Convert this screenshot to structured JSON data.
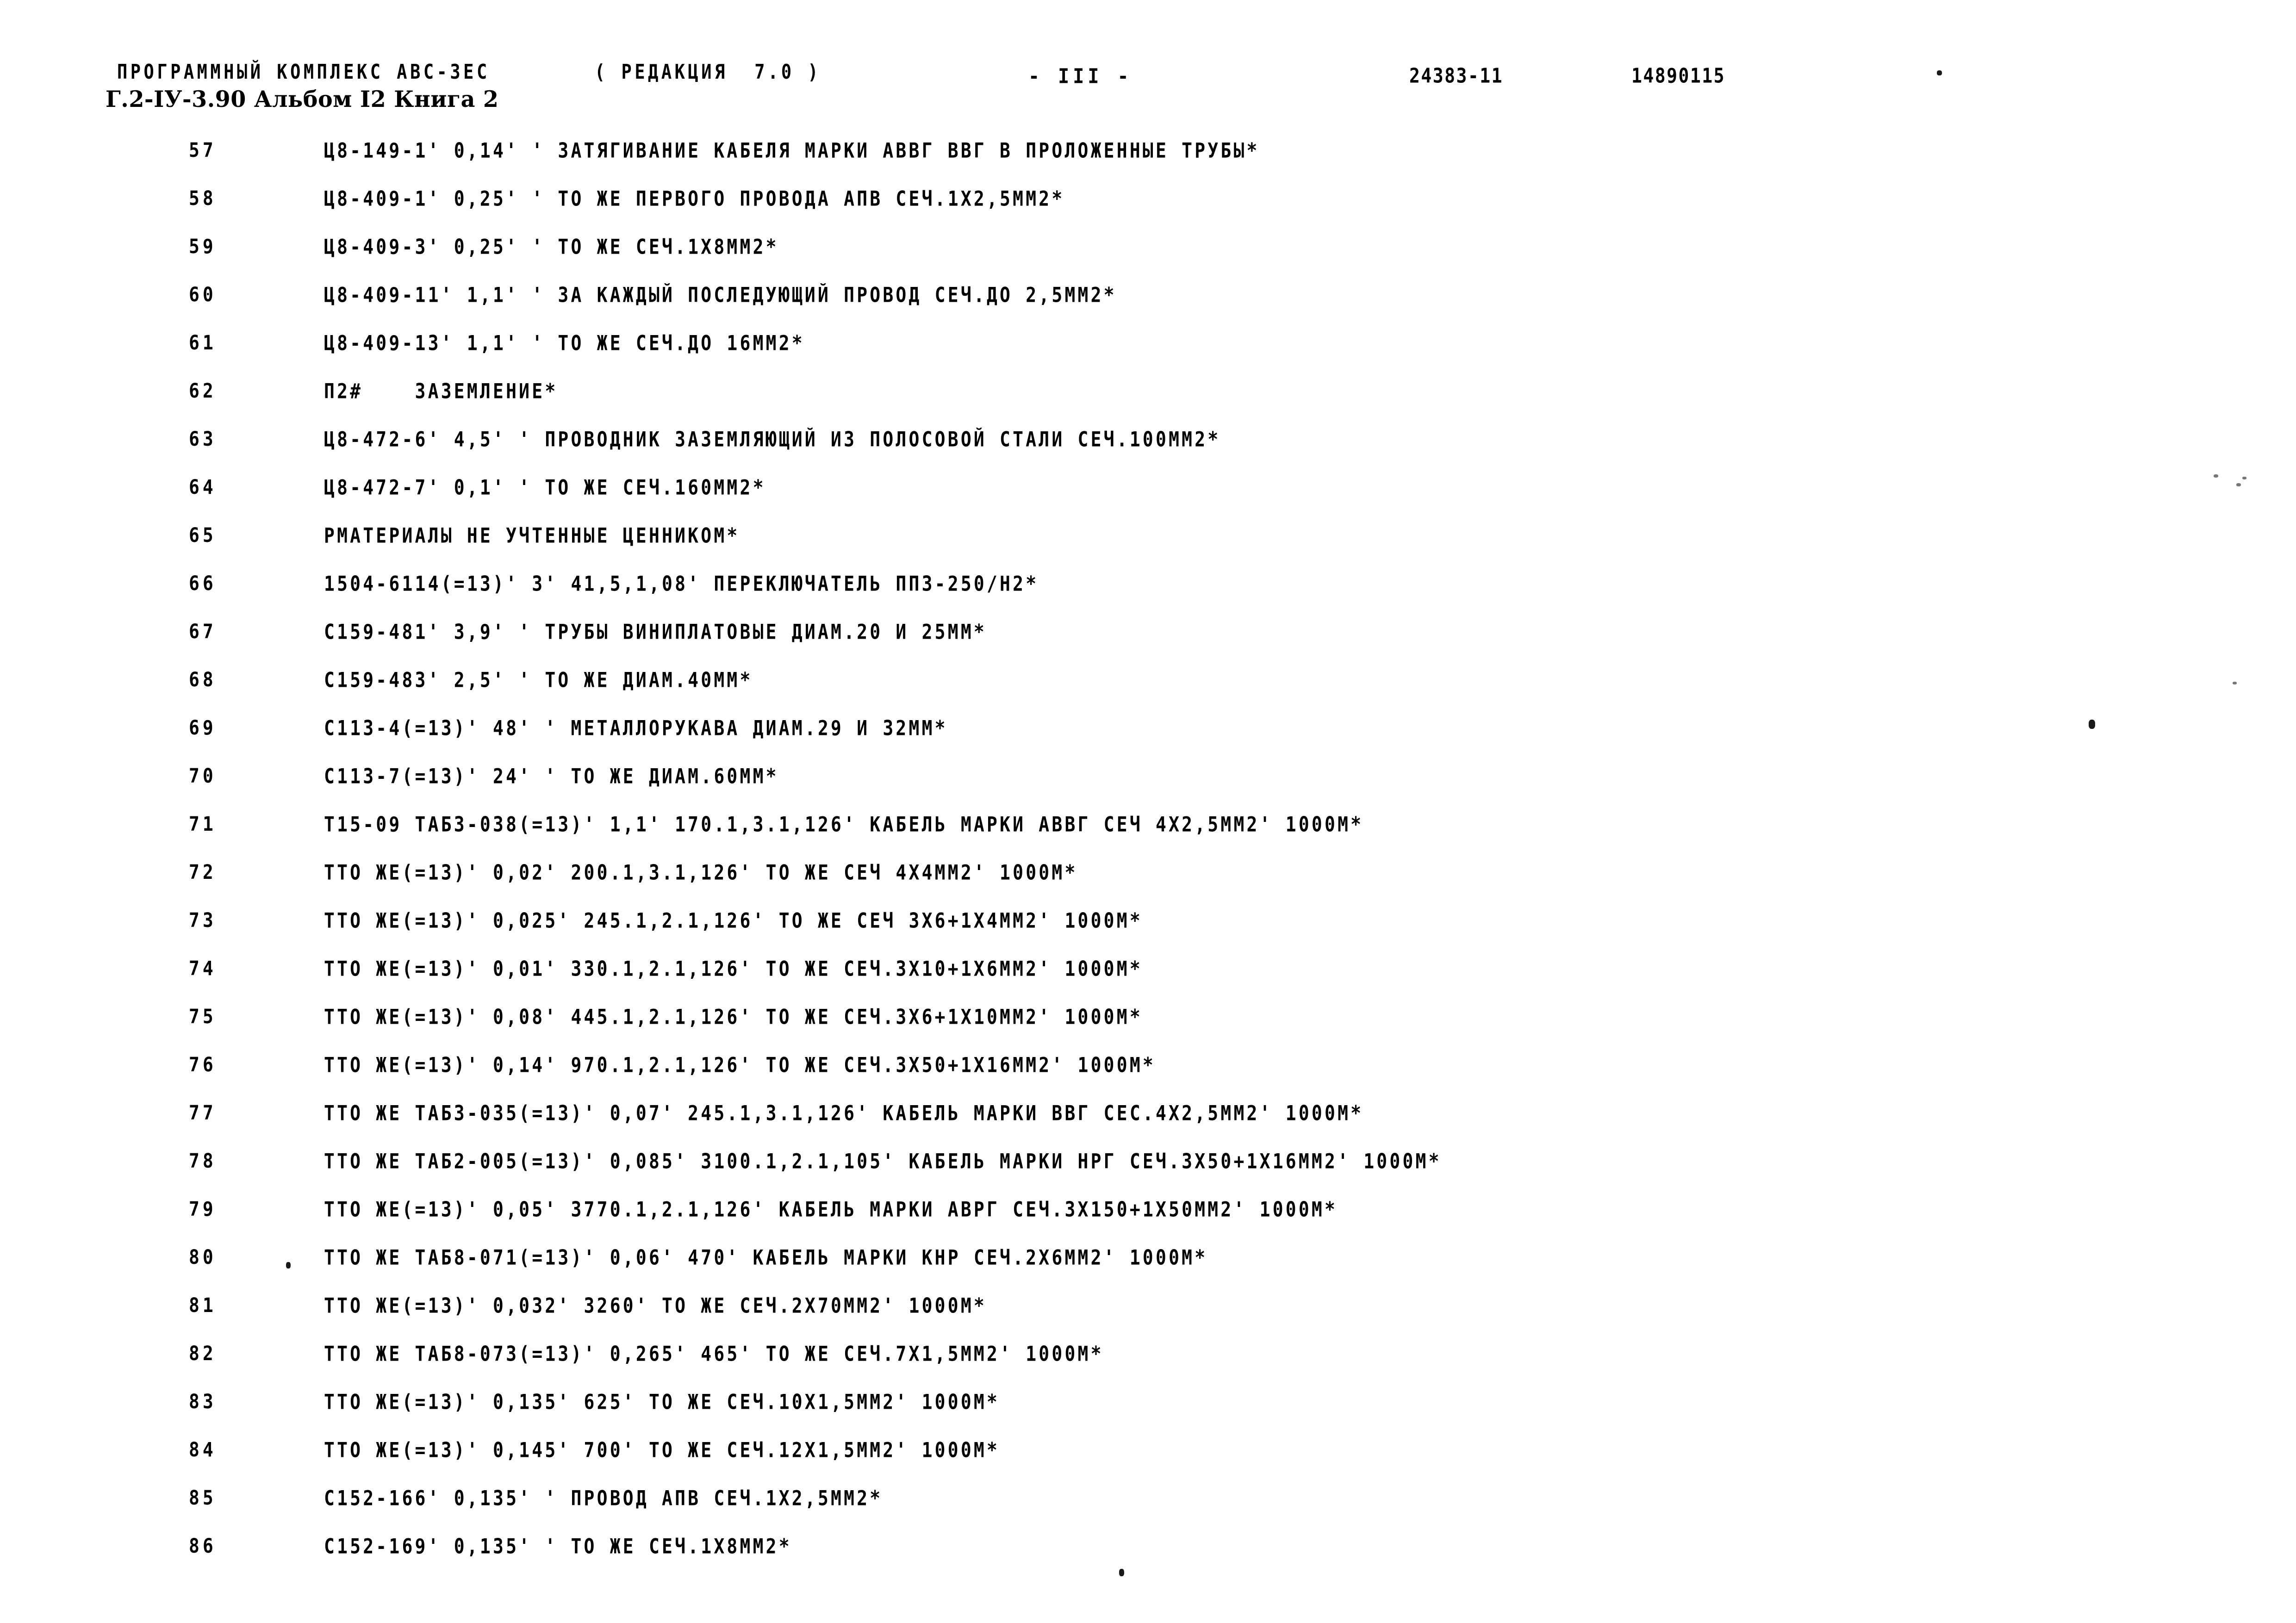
{
  "header": {
    "program_line": "ПРОГРАММНЫЙ КОМПЛЕКС АВС-3ЕС",
    "revision": "( РЕДАКЦИЯ  7.0 )",
    "album_line": "Г.2-IУ-3.90 Альбом I2 Книга 2",
    "page_number": "- III -",
    "code_left": "24383-11",
    "code_right": "14890115"
  },
  "rows": [
    {
      "num": "57",
      "text": "Ц8-149-1' 0,14' ' ЗАТЯГИВАНИЕ КАБЕЛЯ МАРКИ АВВГ ВВГ В ПРОЛОЖЕННЫЕ ТРУБЫ*"
    },
    {
      "num": "58",
      "text": "Ц8-409-1' 0,25' ' ТО ЖЕ ПЕРВОГО ПРОВОДА АПВ СЕЧ.1Х2,5ММ2*"
    },
    {
      "num": "59",
      "text": "Ц8-409-3' 0,25' ' ТО ЖЕ СЕЧ.1Х8ММ2*"
    },
    {
      "num": "60",
      "text": "Ц8-409-11' 1,1' ' ЗА КАЖДЫЙ ПОСЛЕДУЮЩИЙ ПРОВОД СЕЧ.ДО 2,5ММ2*"
    },
    {
      "num": "61",
      "text": "Ц8-409-13' 1,1' ' ТО ЖЕ СЕЧ.ДО 16ММ2*"
    },
    {
      "num": "62",
      "text": "П2#    ЗАЗЕМЛЕНИЕ*"
    },
    {
      "num": "63",
      "text": "Ц8-472-6' 4,5' ' ПРОВОДНИК ЗАЗЕМЛЯЮЩИЙ ИЗ ПОЛОСОВОЙ СТАЛИ СЕЧ.100ММ2*"
    },
    {
      "num": "64",
      "text": "Ц8-472-7' 0,1' ' ТО ЖЕ СЕЧ.160ММ2*"
    },
    {
      "num": "65",
      "text": "РМАТЕРИАЛЫ НЕ УЧТЕННЫЕ ЦЕННИКОМ*"
    },
    {
      "num": "66",
      "text": "1504-6114(=13)' 3' 41,5,1,08' ПЕРЕКЛЮЧАТЕЛЬ ПП3-250/Н2*"
    },
    {
      "num": "67",
      "text": "С159-481' 3,9' ' ТРУБЫ ВИНИПЛАТОВЫЕ ДИАМ.20 И 25ММ*"
    },
    {
      "num": "68",
      "text": "С159-483' 2,5' ' ТО ЖЕ ДИАМ.40ММ*"
    },
    {
      "num": "69",
      "text": "С113-4(=13)' 48' ' МЕТАЛЛОРУКАВА ДИАМ.29 И 32ММ*"
    },
    {
      "num": "70",
      "text": "С113-7(=13)' 24' ' ТО ЖЕ ДИАМ.60ММ*"
    },
    {
      "num": "71",
      "text": "Т15-09 ТАБ3-038(=13)' 1,1' 170.1,3.1,126' КАБЕЛЬ МАРКИ АВВГ СЕЧ 4Х2,5ММ2' 1000М*"
    },
    {
      "num": "72",
      "text": "ТТО ЖЕ(=13)' 0,02' 200.1,3.1,126' ТО ЖЕ СЕЧ 4Х4ММ2' 1000М*"
    },
    {
      "num": "73",
      "text": "ТТО ЖЕ(=13)' 0,025' 245.1,2.1,126' ТО ЖЕ СЕЧ 3Х6+1Х4ММ2' 1000М*"
    },
    {
      "num": "74",
      "text": "ТТО ЖЕ(=13)' 0,01' 330.1,2.1,126' ТО ЖЕ СЕЧ.3Х10+1Х6ММ2' 1000М*"
    },
    {
      "num": "75",
      "text": "ТТО ЖЕ(=13)' 0,08' 445.1,2.1,126' ТО ЖЕ СЕЧ.3Х6+1Х10ММ2' 1000М*"
    },
    {
      "num": "76",
      "text": "ТТО ЖЕ(=13)' 0,14' 970.1,2.1,126' ТО ЖЕ СЕЧ.3Х50+1Х16ММ2' 1000М*"
    },
    {
      "num": "77",
      "text": "ТТО ЖЕ ТАБ3-035(=13)' 0,07' 245.1,3.1,126' КАБЕЛЬ МАРКИ ВВГ СЕС.4Х2,5ММ2' 1000М*"
    },
    {
      "num": "78",
      "text": "ТТО ЖЕ ТАБ2-005(=13)' 0,085' 3100.1,2.1,105' КАБЕЛЬ МАРКИ НРГ СЕЧ.3Х50+1Х16ММ2' 1000М*"
    },
    {
      "num": "79",
      "text": "ТТО ЖЕ(=13)' 0,05' 3770.1,2.1,126' КАБЕЛЬ МАРКИ АВРГ СЕЧ.3Х150+1Х50ММ2' 1000М*"
    },
    {
      "num": "80",
      "text": "ТТО ЖЕ ТАБ8-071(=13)' 0,06' 470' КАБЕЛЬ МАРКИ КНР СЕЧ.2Х6ММ2' 1000М*"
    },
    {
      "num": "81",
      "text": "ТТО ЖЕ(=13)' 0,032' 3260' ТО ЖЕ СЕЧ.2Х70ММ2' 1000М*"
    },
    {
      "num": "82",
      "text": "ТТО ЖЕ ТАБ8-073(=13)' 0,265' 465' ТО ЖЕ СЕЧ.7Х1,5ММ2' 1000М*"
    },
    {
      "num": "83",
      "text": "ТТО ЖЕ(=13)' 0,135' 625' ТО ЖЕ СЕЧ.10Х1,5ММ2' 1000М*"
    },
    {
      "num": "84",
      "text": "ТТО ЖЕ(=13)' 0,145' 700' ТО ЖЕ СЕЧ.12Х1,5ММ2' 1000М*"
    },
    {
      "num": "85",
      "text": "С152-166' 0,135' ' ПРОВОД АПВ СЕЧ.1Х2,5ММ2*"
    },
    {
      "num": "86",
      "text": "С152-169' 0,135' ' ТО ЖЕ СЕЧ.1Х8ММ2*"
    }
  ]
}
